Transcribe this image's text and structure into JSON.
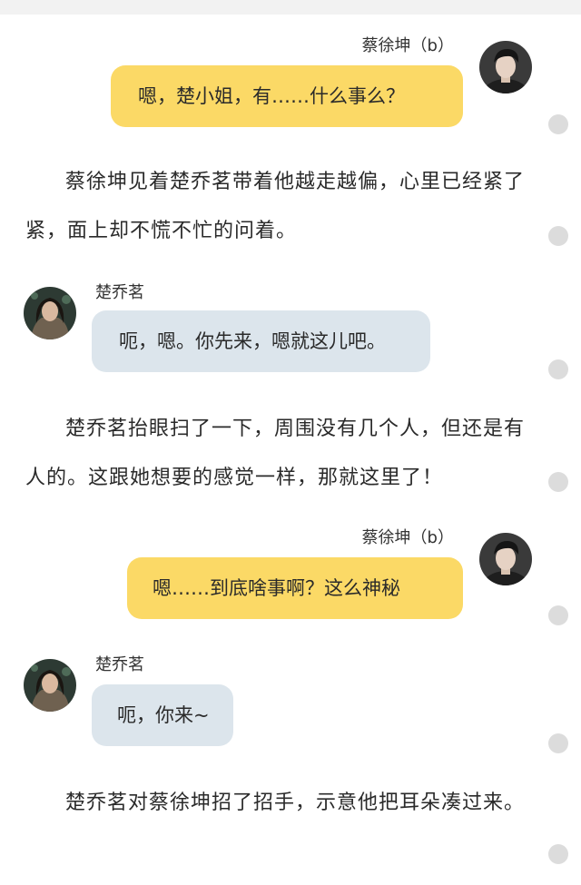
{
  "messages": [
    {
      "speaker": "蔡徐坤（b）",
      "text": "嗯，楚小姐，有……什么事么？"
    },
    {
      "narration": "蔡徐坤见着楚乔茗带着他越走越偏，心里已经紧了紧，面上却不慌不忙的问着。"
    },
    {
      "speaker": "楚乔茗",
      "text": "呃，嗯。你先来，嗯就这儿吧。"
    },
    {
      "narration": "楚乔茗抬眼扫了一下，周围没有几个人，但还是有人的。这跟她想要的感觉一样，那就这里了！"
    },
    {
      "speaker": "蔡徐坤（b）",
      "text": "嗯……到底啥事啊？这么神秘"
    },
    {
      "speaker": "楚乔茗",
      "text": "呃，你来~"
    },
    {
      "narration": "楚乔茗对蔡徐坤招了招手，示意他把耳朵凑过来。"
    }
  ],
  "colors": {
    "male_bubble": "#fbd966",
    "female_bubble": "#dce5ec",
    "side_dot": "#dcdcdc"
  },
  "icons": {
    "male_avatar": "avatar-male-portrait",
    "female_avatar": "avatar-female-portrait",
    "side_dot": "side-dot-icon"
  }
}
